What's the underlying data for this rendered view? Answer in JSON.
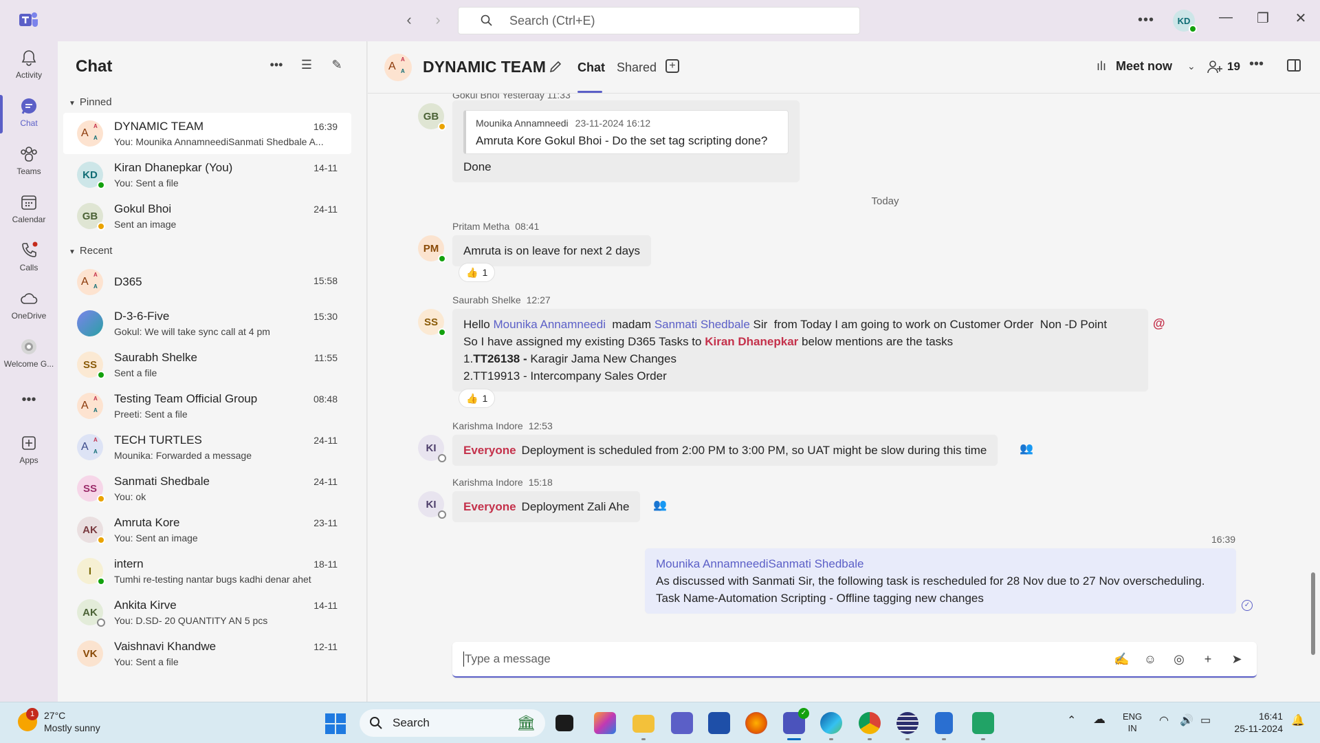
{
  "titlebar": {
    "search_placeholder": "Search (Ctrl+E)",
    "user_initials": "KD"
  },
  "rail": {
    "items": [
      {
        "label": "Activity",
        "icon": "bell-icon"
      },
      {
        "label": "Chat",
        "icon": "chat-icon"
      },
      {
        "label": "Teams",
        "icon": "teams-icon"
      },
      {
        "label": "Calendar",
        "icon": "calendar-icon"
      },
      {
        "label": "Calls",
        "icon": "phone-icon"
      },
      {
        "label": "OneDrive",
        "icon": "cloud-icon"
      },
      {
        "label": "Welcome G...",
        "icon": "welcome-icon"
      },
      {
        "label": "Apps",
        "icon": "apps-icon"
      }
    ]
  },
  "chatlist": {
    "title": "Chat",
    "pinned_label": "Pinned",
    "recent_label": "Recent",
    "pinned": [
      {
        "name": "DYNAMIC TEAM",
        "preview": "You: Mounika AnnamneediSanmati Shedbale A...",
        "time": "16:39",
        "initials": "A"
      },
      {
        "name": "Kiran Dhanepkar (You)",
        "preview": "You: Sent a file",
        "time": "14-11",
        "initials": "KD"
      },
      {
        "name": "Gokul Bhoi",
        "preview": "Sent an image",
        "time": "24-11",
        "initials": "GB"
      }
    ],
    "recent": [
      {
        "name": "D365",
        "preview": "",
        "time": "15:58",
        "initials": "A"
      },
      {
        "name": "D-3-6-Five",
        "preview": "Gokul: We will take sync call at 4 pm",
        "time": "15:30",
        "initials": ""
      },
      {
        "name": "Saurabh Shelke",
        "preview": "Sent a file",
        "time": "11:55",
        "initials": "SS"
      },
      {
        "name": "Testing Team Official Group",
        "preview": "Preeti: Sent a file",
        "time": "08:48",
        "initials": "A"
      },
      {
        "name": "TECH TURTLES",
        "preview": "Mounika: Forwarded a message",
        "time": "24-11",
        "initials": "A"
      },
      {
        "name": "Sanmati Shedbale",
        "preview": "You: ok",
        "time": "24-11",
        "initials": "SS"
      },
      {
        "name": "Amruta Kore",
        "preview": "You: Sent an image",
        "time": "23-11",
        "initials": "AK"
      },
      {
        "name": "intern",
        "preview": "Tumhi re-testing nantar bugs kadhi denar ahet",
        "time": "18-11",
        "initials": "I"
      },
      {
        "name": "Ankita Kirve",
        "preview": "You: D.SD- 20  QUANTITY AN 5 pcs",
        "time": "14-11",
        "initials": "AK"
      },
      {
        "name": "Vaishnavi Khandwe",
        "preview": "You: Sent a file",
        "time": "12-11",
        "initials": "VK"
      }
    ]
  },
  "header": {
    "title": "DYNAMIC TEAM",
    "tab_chat": "Chat",
    "tab_shared": "Shared",
    "meet_now": "Meet now",
    "participants": "19"
  },
  "messages": {
    "gokul": {
      "meta": "Gokul Bhoi  Yesterday 11:33",
      "initials": "GB",
      "quote_author": "Mounika Annamneedi",
      "quote_time": "23-11-2024 16:12",
      "quote_text": "Amruta Kore Gokul Bhoi - Do the set tag scripting done?",
      "text": "Done"
    },
    "today_label": "Today",
    "pritam": {
      "name": "Pritam Metha",
      "time": "08:41",
      "initials": "PM",
      "text": "Amruta is on leave for next 2 days",
      "reaction_count": "1"
    },
    "saurabh": {
      "name": "Saurabh Shelke",
      "time": "12:27",
      "initials": "SS",
      "l1_a": "Hello ",
      "l1_m1": "Mounika Annamneedi",
      "l1_b": "  madam ",
      "l1_m2": "Sanmati Shedbale",
      "l1_c": " Sir  from Today I am going to work on Customer Order  Non -D Point",
      "l2_a": "So I have assigned my existing D365 Tasks to ",
      "l2_m": "Kiran Dhanepkar",
      "l2_b": " below mentions are the tasks",
      "l3_a": "1.",
      "l3_b": "TT26138 -",
      "l3_c": " Karagir Jama New Changes",
      "l4": "2.TT19913 - Intercompany Sales Order",
      "reaction_count": "1"
    },
    "karishma1": {
      "name": "Karishma Indore",
      "time": "12:53",
      "initials": "KI",
      "tag": "Everyone",
      "text": "Deployment is scheduled from 2:00 PM to 3:00 PM, so UAT might be slow during this time"
    },
    "karishma2": {
      "name": "Karishma Indore",
      "time": "15:18",
      "initials": "KI",
      "tag": "Everyone",
      "text": "Deployment Zali Ahe"
    },
    "mine": {
      "time": "16:39",
      "mentions": "Mounika AnnamneediSanmati Shedbale",
      "line1": "As discussed with Sanmati Sir,  the following task is rescheduled for 28 Nov due to 27 Nov overscheduling.",
      "line2": "Task Name-Automation Scripting - Offline tagging new changes"
    }
  },
  "compose": {
    "placeholder": "Type a message"
  },
  "taskbar": {
    "weather_temp": "27°C",
    "weather_desc": "Mostly sunny",
    "weather_badge": "1",
    "search_label": "Search",
    "lang_1": "ENG",
    "lang_2": "IN",
    "time": "16:41",
    "date": "25-11-2024"
  },
  "colors": {
    "accent": "#5b5fc7",
    "mention_red": "#c4314b",
    "online": "#13a10e",
    "away": "#eaa300"
  }
}
